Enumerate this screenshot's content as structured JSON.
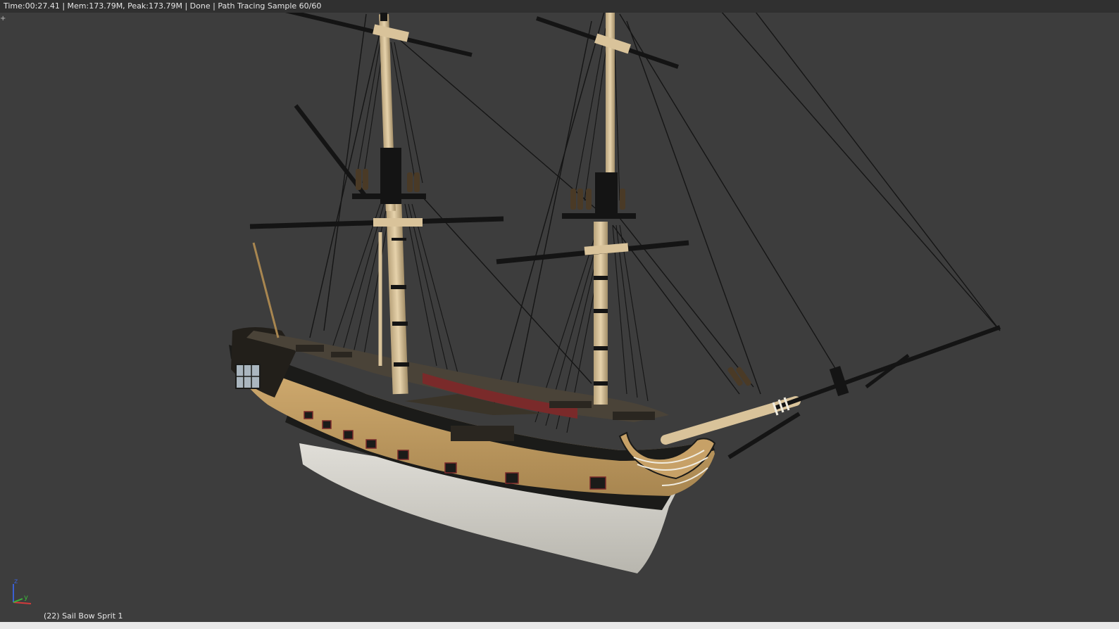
{
  "header": {
    "status_text": "Time:00:27.41 | Mem:173.79M, Peak:173.79M | Done | Path Tracing Sample 60/60"
  },
  "viewport": {
    "background_color": "#3d3d3d",
    "corner_widget_glyph": "+",
    "object_label": "(22) Sail Bow Sprit 1"
  },
  "axis_gizmo": {
    "z_label": "z",
    "y_label": "y",
    "x_color": "#d23b3b",
    "y_color": "#3bb53b",
    "z_color": "#3b5fd2"
  },
  "scene": {
    "subject": "three-dimensional sailing ship model render",
    "colors": {
      "hull_wood": "#c7a167",
      "hull_black": "#1b1b19",
      "hull_bottom": "#cfcdc6",
      "mast_wood": "#d9c39a",
      "spar_black": "#141414",
      "rigging": "#151515",
      "accent_red": "#7a2a2a"
    }
  }
}
